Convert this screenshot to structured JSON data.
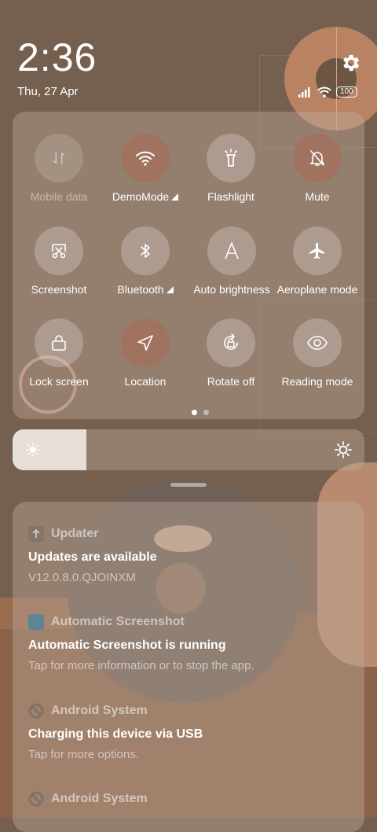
{
  "status": {
    "time": "2:36",
    "date": "Thu, 27 Apr",
    "battery": "100",
    "icons": [
      "signal-icon",
      "wifi-icon",
      "battery-icon",
      "gear-icon"
    ]
  },
  "quick_settings": {
    "tiles": [
      {
        "label": "Mobile data",
        "icon": "mobile-data-icon",
        "state": "disabled"
      },
      {
        "label": "DemoMode",
        "icon": "wifi-icon",
        "state": "on",
        "expandable": true
      },
      {
        "label": "Flashlight",
        "icon": "flashlight-icon",
        "state": "off"
      },
      {
        "label": "Mute",
        "icon": "bell-off-icon",
        "state": "on"
      },
      {
        "label": "Screenshot",
        "icon": "scissors-icon",
        "state": "off"
      },
      {
        "label": "Bluetooth",
        "icon": "bluetooth-icon",
        "state": "off",
        "expandable": true
      },
      {
        "label": "Auto brightness",
        "icon": "letter-a-icon",
        "state": "off"
      },
      {
        "label": "Aeroplane mode",
        "icon": "airplane-icon",
        "state": "off"
      },
      {
        "label": "Lock screen",
        "icon": "lock-icon",
        "state": "off"
      },
      {
        "label": "Location",
        "icon": "location-arrow-icon",
        "state": "on"
      },
      {
        "label": "Rotate off",
        "icon": "rotate-lock-icon",
        "state": "off"
      },
      {
        "label": "Reading mode",
        "icon": "eye-icon",
        "state": "off"
      }
    ],
    "page_count": 2,
    "current_page": 1
  },
  "brightness": {
    "level": 0.21
  },
  "notifications": [
    {
      "app": "Updater",
      "title": "Updates are available",
      "body": "V12.0.8.0.QJOINXM"
    },
    {
      "app": "Automatic Screenshot",
      "title": "Automatic Screenshot is running",
      "body": "Tap for more information or to stop the app."
    },
    {
      "app": "Android System",
      "title": "Charging this device via USB",
      "body": "Tap for more options."
    },
    {
      "app": "Android System",
      "title": "",
      "body": ""
    }
  ],
  "colors": {
    "tile_on": "#a07260",
    "wallpaper": "#75604f"
  }
}
